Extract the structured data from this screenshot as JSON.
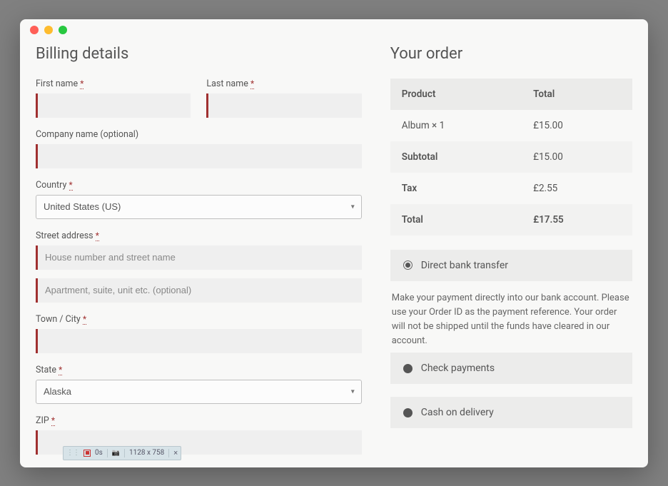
{
  "billing": {
    "heading": "Billing details",
    "first_name_label": "First name",
    "last_name_label": "Last name",
    "company_label": "Company name (optional)",
    "country_label": "Country",
    "country_value": "United States (US)",
    "street_label": "Street address",
    "street_ph1": "House number and street name",
    "street_ph2": "Apartment, suite, unit etc. (optional)",
    "city_label": "Town / City",
    "state_label": "State",
    "state_value": "Alaska",
    "zip_label": "ZIP",
    "required_mark": "*"
  },
  "order": {
    "heading": "Your order",
    "col_product": "Product",
    "col_total": "Total",
    "item_name": "Album  × 1",
    "item_total": "£15.00",
    "subtotal_label": "Subtotal",
    "subtotal_value": "£15.00",
    "tax_label": "Tax",
    "tax_value": "£2.55",
    "total_label": "Total",
    "total_value": "£17.55"
  },
  "payment": {
    "opt1": "Direct bank transfer",
    "opt1_desc": "Make your payment directly into our bank account. Please use your Order ID as the payment reference. Your order will not be shipped until the funds have cleared in our account.",
    "opt2": "Check payments",
    "opt3": "Cash on delivery"
  },
  "recorder": {
    "time": "0s",
    "dims": "1128 x 758"
  }
}
